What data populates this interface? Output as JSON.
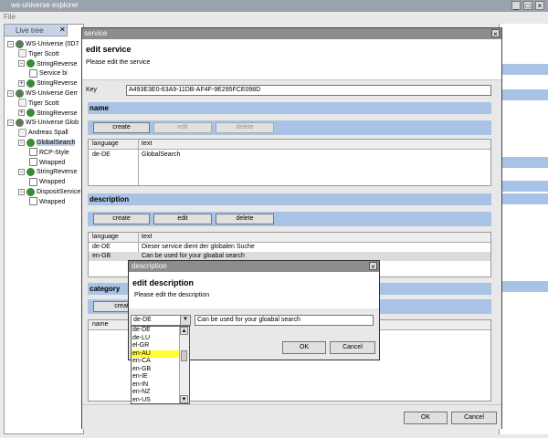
{
  "main_window": {
    "title": "ws-universe explorer",
    "menu": "File"
  },
  "tree_tab": {
    "label": "Live tree",
    "close": "✕"
  },
  "tree": [
    {
      "label": "WS-Universe (0D7",
      "icon": "world-icon",
      "expand": "−"
    },
    {
      "label": "Tiger Scott",
      "icon": "person-icon"
    },
    {
      "label": "StringReverse",
      "icon": "service-icon",
      "expand": "−"
    },
    {
      "label": "Service bi",
      "icon": "binding-icon"
    },
    {
      "label": "StringReverse",
      "icon": "service-icon",
      "expand": "+"
    },
    {
      "label": "WS-Universe Gerr",
      "icon": "world-icon",
      "expand": "−"
    },
    {
      "label": "Tiger Scott",
      "icon": "person-icon"
    },
    {
      "label": "StringReverse",
      "icon": "service-icon",
      "expand": "+"
    },
    {
      "label": "WS-Universe Glob",
      "icon": "world-icon",
      "expand": "−"
    },
    {
      "label": "Andreas Spall",
      "icon": "person-icon"
    },
    {
      "label": "GlobalSearch",
      "icon": "service-icon",
      "expand": "−",
      "selected": true
    },
    {
      "label": "RCP-Style",
      "icon": "binding-icon"
    },
    {
      "label": "Wrapped",
      "icon": "binding-icon"
    },
    {
      "label": "StringReverse",
      "icon": "service-icon",
      "expand": "−"
    },
    {
      "label": "Wrapped",
      "icon": "binding-icon"
    },
    {
      "label": "DispositService",
      "icon": "service-icon",
      "expand": "−"
    },
    {
      "label": "Wrapped",
      "icon": "binding-icon"
    }
  ],
  "service_dialog": {
    "title": "service",
    "heading": "edit service",
    "subtitle": "Please edit the service",
    "key_label": "Key",
    "key_value": "A493E3E0-63A9-11DB-AF4F-9E295FCE098D",
    "name_section": {
      "label": "name",
      "buttons": {
        "create": "create",
        "edit": "edit",
        "delete": "delete"
      },
      "columns": [
        "language",
        "text"
      ],
      "rows": [
        [
          "de-DE",
          "GlobalSearch"
        ]
      ]
    },
    "description_section": {
      "label": "description",
      "buttons": {
        "create": "create",
        "edit": "edit",
        "delete": "delete"
      },
      "columns": [
        "language",
        "text"
      ],
      "rows": [
        [
          "de-DE",
          "Dieser service dient der globalen Suche"
        ],
        [
          "en-GB",
          "Can be used for your gloabal search"
        ]
      ]
    },
    "category_section": {
      "label": "category",
      "create_partial": "creat",
      "column_partial": "name"
    },
    "ok": "OK",
    "cancel": "Cancel"
  },
  "description_dialog": {
    "title": "description",
    "heading": "edit description",
    "subtitle": "Please edit the description",
    "language_value": "de-DE",
    "text_value": "Can be used for your gloabal search",
    "ok": "OK",
    "cancel": "Cancel"
  },
  "language_options": [
    "de-DE",
    "de-LU",
    "el-GR",
    "en-AU",
    "en-CA",
    "en-GB",
    "en-IE",
    "en-IN",
    "en-NZ",
    "en-US"
  ],
  "language_highlighted": "en-AU",
  "colors": {
    "band": "#a9c3e6",
    "highlight": "#ffff33",
    "titlebar": "#8d8d8d"
  }
}
